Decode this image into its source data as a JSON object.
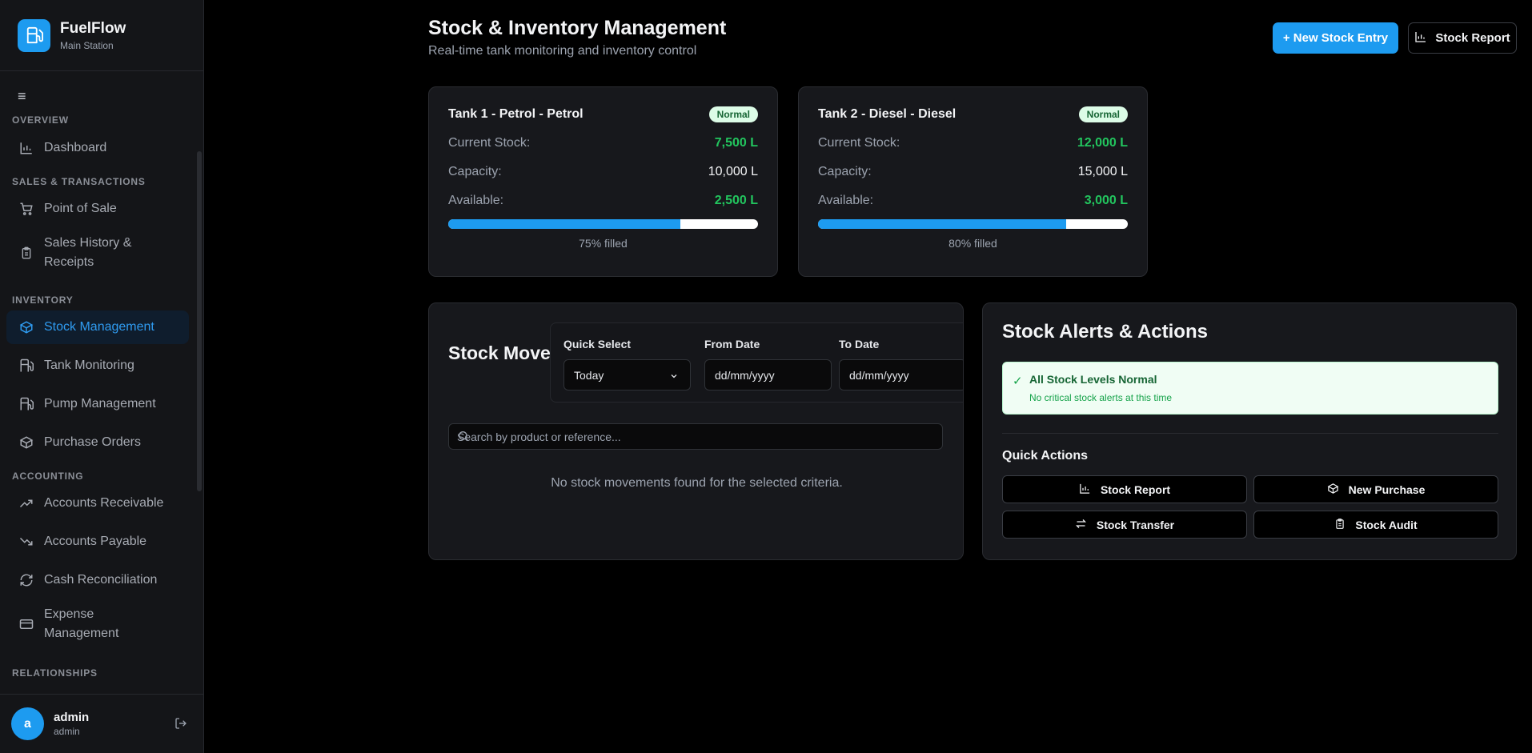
{
  "brand": {
    "name": "FuelFlow",
    "subtitle": "Main Station",
    "icon": "fuel-pump-icon"
  },
  "sidebar": {
    "menu_icon": "≡",
    "sections": {
      "overview": "OVERVIEW",
      "sales": "SALES & TRANSACTIONS",
      "inventory": "INVENTORY",
      "accounting": "ACCOUNTING",
      "relationships": "RELATIONSHIPS"
    },
    "items": [
      {
        "label": "Dashboard",
        "icon": "bar-chart-icon"
      },
      {
        "label": "Point of Sale",
        "icon": "cart-icon"
      },
      {
        "label": "Sales History & Receipts",
        "icon": "clipboard-icon"
      },
      {
        "label": "Stock Management",
        "icon": "box-icon",
        "active": true
      },
      {
        "label": "Tank Monitoring",
        "icon": "fuel-icon"
      },
      {
        "label": "Pump Management",
        "icon": "fuel-icon"
      },
      {
        "label": "Purchase Orders",
        "icon": "box-icon"
      },
      {
        "label": "Accounts Receivable",
        "icon": "trending-up-icon"
      },
      {
        "label": "Accounts Payable",
        "icon": "trending-down-icon"
      },
      {
        "label": "Cash Reconciliation",
        "icon": "refresh-icon"
      },
      {
        "label": "Expense Management",
        "icon": "credit-card-icon"
      }
    ],
    "sales_history_lines": [
      "Sales History &",
      "Receipts"
    ],
    "expense_lines": [
      "Expense",
      "Management"
    ]
  },
  "user": {
    "initial": "a",
    "name": "admin",
    "role": "admin"
  },
  "header": {
    "title": "Stock & Inventory Management",
    "subtitle": "Real-time tank monitoring and inventory control",
    "new_entry_label": "+ New Stock Entry",
    "report_label": "Stock Report"
  },
  "tanks": [
    {
      "name": "Tank 1 - Petrol - Petrol",
      "status": "Normal",
      "current_label": "Current Stock:",
      "current": "7,500 L",
      "capacity_label": "Capacity:",
      "capacity": "10,000 L",
      "available_label": "Available:",
      "available": "2,500 L",
      "fill": 0.75,
      "fill_label": "75% filled"
    },
    {
      "name": "Tank 2 - Diesel - Diesel",
      "status": "Normal",
      "current_label": "Current Stock:",
      "current": "12,000 L",
      "capacity_label": "Capacity:",
      "capacity": "15,000 L",
      "available_label": "Available:",
      "available": "3,000 L",
      "fill": 0.8,
      "fill_label": "80% filled"
    }
  ],
  "movements": {
    "title": "Stock Movements",
    "quick_select_label": "Quick Select",
    "quick_select_value": "Today",
    "from_label": "From Date",
    "from_placeholder": "dd/mm/yyyy",
    "to_label": "To Date",
    "to_placeholder": "dd/mm/yyyy",
    "search_placeholder": "Search by product or reference...",
    "empty_text": "No stock movements found for the selected criteria."
  },
  "alerts": {
    "title": "Stock Alerts & Actions",
    "ok_title": "All Stock Levels Normal",
    "ok_sub": "No critical stock alerts at this time",
    "quick_actions_title": "Quick Actions",
    "actions": [
      {
        "label": "Stock Report",
        "icon": "bar-chart-icon"
      },
      {
        "label": "New Purchase",
        "icon": "box-icon"
      },
      {
        "label": "Stock Transfer",
        "icon": "transfer-icon"
      },
      {
        "label": "Stock Audit",
        "icon": "clipboard-icon"
      }
    ]
  },
  "colors": {
    "accent": "#1d9bf0",
    "ok": "#22c55e",
    "bg": "#000000",
    "card": "#17181c"
  }
}
